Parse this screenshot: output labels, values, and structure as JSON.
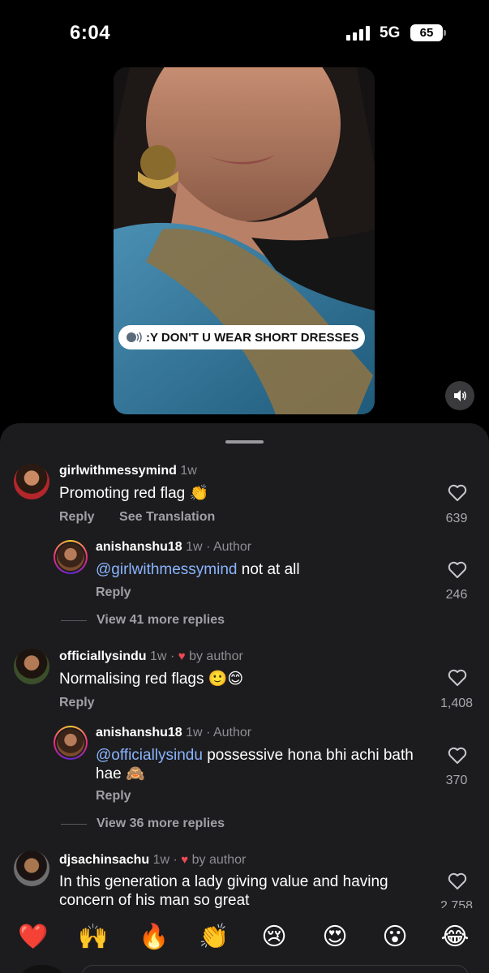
{
  "status": {
    "time": "6:04",
    "network": "5G",
    "battery": "65"
  },
  "video": {
    "caption": ":Y DON'T U WEAR SHORT DRESSES"
  },
  "comments": [
    {
      "user": "girlwithmessymind",
      "time": "1w",
      "text": "Promoting red flag 👏",
      "reply": "Reply",
      "translate": "See Translation",
      "likes": "639"
    },
    {
      "user": "anishanshu18",
      "time": "1w",
      "tag": "Author",
      "mention": "@girlwithmessymind",
      "text": " not at all",
      "reply": "Reply",
      "likes": "246"
    },
    {
      "user": "officiallysindu",
      "time": "1w",
      "byauthor": "by author",
      "text": "Normalising red flags 🙂😊",
      "reply": "Reply",
      "likes": "1,408"
    },
    {
      "user": "anishanshu18",
      "time": "1w",
      "tag": "Author",
      "mention": "@officiallysindu",
      "text": " possessive hona bhi achi bath hae 🙈",
      "reply": "Reply",
      "likes": "370"
    },
    {
      "user": "djsachinsachu",
      "time": "1w",
      "byauthor": "by author",
      "text": "In this generation a lady giving value and having concern of his man so great",
      "likes": "2,758"
    }
  ],
  "view_more": [
    "View 41 more replies",
    "View 36 more replies"
  ],
  "emoji_bar": [
    "❤️",
    "🙌",
    "🔥",
    "👏",
    "😢",
    "😍",
    "😮",
    "😂"
  ],
  "icons": {
    "heart": "heart-outline-icon",
    "speaker": "speaker-icon"
  },
  "colors": {
    "background": "#000000",
    "sheet": "#1c1c1e",
    "mention": "#8ab4ff",
    "heart": "#ed4956"
  }
}
